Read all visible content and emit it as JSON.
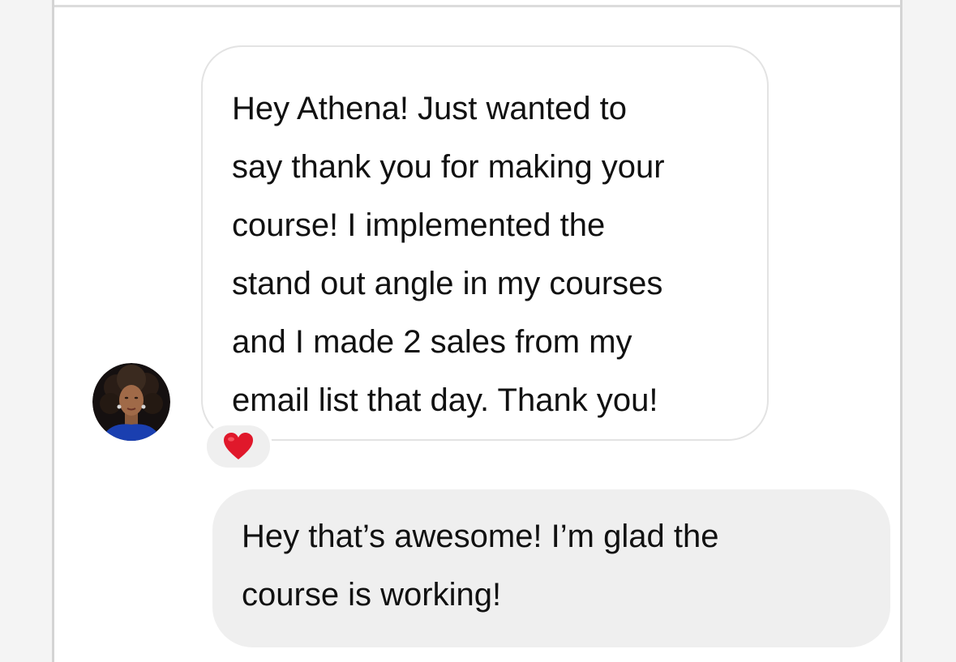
{
  "conversation": {
    "incoming": {
      "avatar_icon": "user-avatar-photo",
      "lines": [
        "Hey Athena! Just wanted to",
        "say thank you for making your",
        "course! I implemented the",
        "stand out angle in my courses",
        "and I made 2 sales from my",
        "email list that day. Thank you!"
      ],
      "reaction": {
        "icon": "red-heart-icon",
        "color": "#e0182b"
      }
    },
    "outgoing": {
      "lines": [
        "Hey that’s awesome! I’m glad the",
        "course is working!"
      ]
    }
  },
  "colors": {
    "incoming_bubble_border": "#e3e3e3",
    "outgoing_bubble_bg": "#efefef",
    "text": "#111111"
  }
}
